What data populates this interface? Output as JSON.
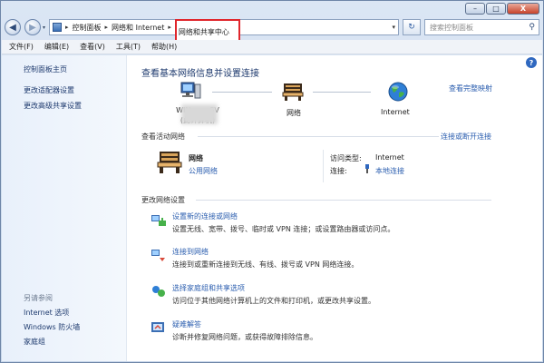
{
  "window": {
    "controls": {
      "minimize": "–",
      "maximize": "□",
      "close": "X"
    }
  },
  "address": {
    "back": "◀",
    "forward": "▶",
    "crumbs": [
      "控制面板",
      "网络和 Internet",
      "网络和共享中心"
    ],
    "separator": "▸",
    "dropdown": "▾",
    "refresh": "↻"
  },
  "search": {
    "placeholder": "搜索控制面板",
    "icon": "⚲"
  },
  "menu": [
    "文件(F)",
    "编辑(E)",
    "查看(V)",
    "工具(T)",
    "帮助(H)"
  ],
  "sidebar": {
    "links": [
      "控制面板主页",
      "更改适配器设置",
      "更改高级共享设置"
    ],
    "see_also_title": "另请参阅",
    "see_also": [
      "Internet 选项",
      "Windows 防火墙",
      "家庭组"
    ]
  },
  "main": {
    "heading": "查看基本网络信息并设置连接",
    "full_map_link": "查看完整映射",
    "nodes": {
      "computer_label": "WIN-",
      "computer_label_suffix": "SV",
      "computer_label_line2": "(此计算机)",
      "network_label": "网络",
      "internet_label": "Internet"
    },
    "active_networks": {
      "label": "查看活动网络",
      "connect_link": "连接或断开连接",
      "network_name": "网络",
      "network_type": "公用网络",
      "access_type_label": "访问类型:",
      "access_type_value": "Internet",
      "connections_label": "连接:",
      "connections_value": "本地连接"
    },
    "change_settings": {
      "label": "更改网络设置",
      "tasks": [
        {
          "title": "设置新的连接或网络",
          "desc": "设置无线、宽带、拨号、临时或 VPN 连接；或设置路由器或访问点。"
        },
        {
          "title": "连接到网络",
          "desc": "连接到或重新连接到无线、有线、拨号或 VPN 网络连接。"
        },
        {
          "title": "选择家庭组和共享选项",
          "desc": "访问位于其他网络计算机上的文件和打印机，或更改共享设置。"
        },
        {
          "title": "疑难解答",
          "desc": "诊断并修复网络问题，或获得故障排除信息。"
        }
      ]
    }
  },
  "help_label": "?"
}
